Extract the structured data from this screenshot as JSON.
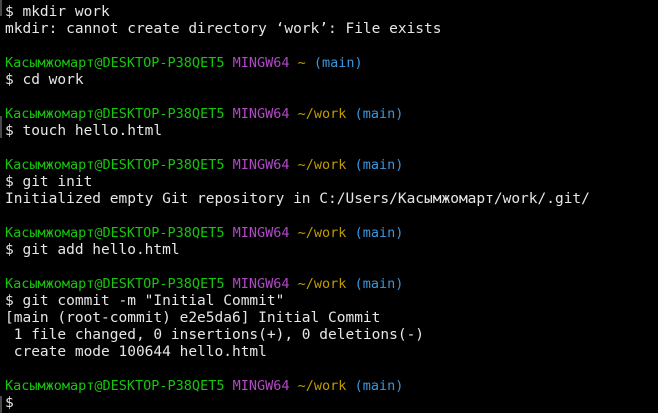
{
  "terminal": {
    "prompt_user": "Касымжомарт@DESKTOP-P38QET5",
    "prompt_system": "MINGW64",
    "lines": [
      {
        "text": "$ mkdir work"
      },
      {
        "text": "mkdir: cannot create directory ‘work’: File exists"
      },
      {
        "blank": true
      },
      {
        "prompt": true,
        "path": "~",
        "branch": "(main)"
      },
      {
        "text": "$ cd work"
      },
      {
        "blank": true
      },
      {
        "prompt": true,
        "path": "~/work",
        "branch": "(main)"
      },
      {
        "text": "$ touch hello.html"
      },
      {
        "blank": true
      },
      {
        "prompt": true,
        "path": "~/work",
        "branch": "(main)"
      },
      {
        "text": "$ git init"
      },
      {
        "text": "Initialized empty Git repository in C:/Users/Касымжомарт/work/.git/"
      },
      {
        "blank": true
      },
      {
        "prompt": true,
        "path": "~/work",
        "branch": "(main)"
      },
      {
        "text": "$ git add hello.html"
      },
      {
        "blank": true
      },
      {
        "prompt": true,
        "path": "~/work",
        "branch": "(main)"
      },
      {
        "text": "$ git commit -m \"Initial Commit\""
      },
      {
        "text": "[main (root-commit) e2e5da6] Initial Commit"
      },
      {
        "text": " 1 file changed, 0 insertions(+), 0 deletions(-)"
      },
      {
        "text": " create mode 100644 hello.html"
      },
      {
        "blank": true
      },
      {
        "prompt": true,
        "path": "~/work",
        "branch": "(main)"
      },
      {
        "text": "$ ",
        "cursor": true
      }
    ]
  },
  "colors": {
    "background": "#000000",
    "text": "#e6e6e6",
    "user": "#16c60c",
    "system": "#b148c6",
    "path": "#c19c00",
    "branch": "#3a96dd"
  }
}
